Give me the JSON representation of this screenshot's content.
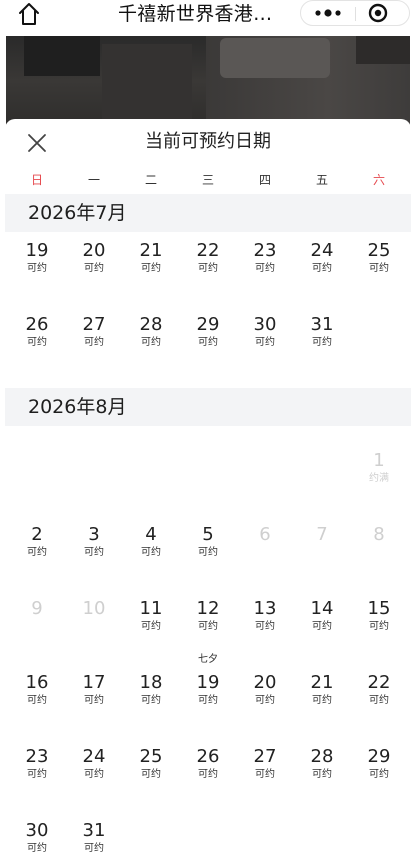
{
  "topbar": {
    "title": "千禧新世界香港…"
  },
  "sheet": {
    "title": "当前可预约日期"
  },
  "weekdays": [
    "日",
    "一",
    "二",
    "三",
    "四",
    "五",
    "六"
  ],
  "colors": {
    "weekend": "#e5484d",
    "disabled": "#cfcfcf",
    "month_header_bg": "#f3f4f6"
  },
  "months": [
    {
      "title": "2026年7月",
      "days": [
        {
          "num": "19",
          "status": "可约"
        },
        {
          "num": "20",
          "status": "可约"
        },
        {
          "num": "21",
          "status": "可约"
        },
        {
          "num": "22",
          "status": "可约"
        },
        {
          "num": "23",
          "status": "可约"
        },
        {
          "num": "24",
          "status": "可约"
        },
        {
          "num": "25",
          "status": "可约"
        },
        {
          "num": "26",
          "status": "可约"
        },
        {
          "num": "27",
          "status": "可约"
        },
        {
          "num": "28",
          "status": "可约"
        },
        {
          "num": "29",
          "status": "可约"
        },
        {
          "num": "30",
          "status": "可约"
        },
        {
          "num": "31",
          "status": "可约"
        }
      ]
    },
    {
      "title": "2026年8月",
      "days": [
        {
          "num": "1",
          "status": "约满",
          "disabled": true
        },
        {
          "num": "2",
          "status": "可约"
        },
        {
          "num": "3",
          "status": "可约"
        },
        {
          "num": "4",
          "status": "可约"
        },
        {
          "num": "5",
          "status": "可约"
        },
        {
          "num": "6",
          "status": "",
          "disabled": true
        },
        {
          "num": "7",
          "status": "",
          "disabled": true
        },
        {
          "num": "8",
          "status": "",
          "disabled": true
        },
        {
          "num": "9",
          "status": "",
          "disabled": true
        },
        {
          "num": "10",
          "status": "",
          "disabled": true
        },
        {
          "num": "11",
          "status": "可约"
        },
        {
          "num": "12",
          "status": "可约"
        },
        {
          "num": "13",
          "status": "可约"
        },
        {
          "num": "14",
          "status": "可约"
        },
        {
          "num": "15",
          "status": "可约"
        },
        {
          "num": "16",
          "status": "可约"
        },
        {
          "num": "17",
          "status": "可约"
        },
        {
          "num": "18",
          "status": "可约"
        },
        {
          "num": "19",
          "status": "可约",
          "festival": "七夕"
        },
        {
          "num": "20",
          "status": "可约"
        },
        {
          "num": "21",
          "status": "可约"
        },
        {
          "num": "22",
          "status": "可约"
        },
        {
          "num": "23",
          "status": "可约"
        },
        {
          "num": "24",
          "status": "可约"
        },
        {
          "num": "25",
          "status": "可约"
        },
        {
          "num": "26",
          "status": "可约"
        },
        {
          "num": "27",
          "status": "可约"
        },
        {
          "num": "28",
          "status": "可约"
        },
        {
          "num": "29",
          "status": "可约"
        },
        {
          "num": "30",
          "status": "可约"
        },
        {
          "num": "31",
          "status": "可约"
        }
      ]
    }
  ]
}
